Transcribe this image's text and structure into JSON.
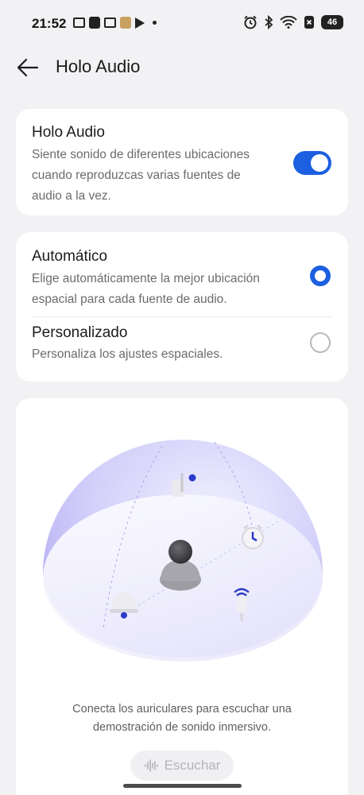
{
  "status_bar": {
    "time": "21:52",
    "battery": "46",
    "icons": [
      "gmail-icon",
      "tiktok-icon",
      "gmail-icon",
      "cake-icon",
      "play-icon",
      "alarm-icon",
      "bluetooth-icon",
      "wifi-icon",
      "sim-icon",
      "battery-icon"
    ]
  },
  "header": {
    "title": "Holo Audio",
    "back_icon": "arrow-left-icon"
  },
  "holo_card": {
    "title": "Holo Audio",
    "description_lines": [
      "Siente sonido de diferentes ubicaciones",
      "cuando reproduzcas varias fuentes de",
      "audio a la vez."
    ],
    "toggle_on": true
  },
  "mode_options": [
    {
      "title": "Automático",
      "description_lines": [
        "Elige automáticamente la mejor ubicación",
        "espacial para cada fuente de audio."
      ],
      "selected": true
    },
    {
      "title": "Personalizado",
      "description_lines": [
        "Personaliza los ajustes espaciales."
      ],
      "selected": false
    }
  ],
  "demo": {
    "caption_lines": [
      "Conecta los auriculares para escuchar una",
      "demostración de sonido inmersivo."
    ],
    "listen_label": "Escuchar",
    "listen_icon": "waveform-icon",
    "illustration_icons": [
      "music-note-icon",
      "alarm-clock-icon",
      "person-avatar-icon",
      "bell-icon",
      "microphone-icon"
    ]
  },
  "colors": {
    "accent": "#1c5fe0",
    "background": "#f2f2f4",
    "card": "#ffffff",
    "dome": "#c9c6f7"
  }
}
